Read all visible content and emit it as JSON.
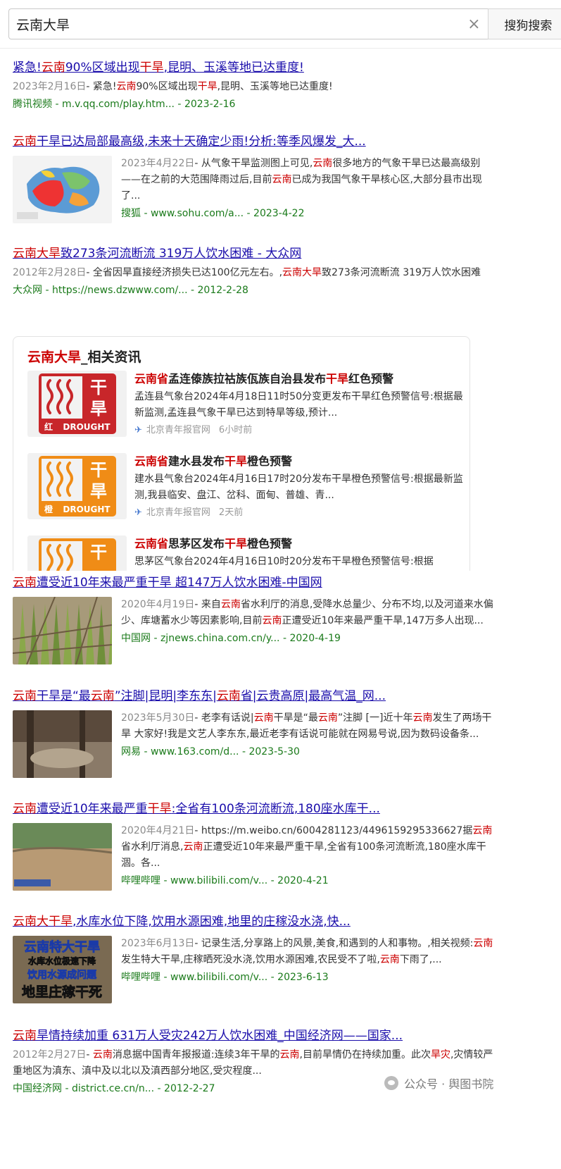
{
  "search": {
    "query": "云南大旱",
    "button_label": "搜狗搜索",
    "clear_label": "×"
  },
  "results": [
    {
      "title_parts": [
        [
          "紧急!",
          ""
        ],
        [
          "云南",
          "em"
        ],
        [
          "90%区域出现",
          ""
        ],
        [
          "干旱",
          "em"
        ],
        [
          ",昆明、玉溪等地已达重度!",
          ""
        ]
      ],
      "date": "2023年2月16日",
      "snippet_parts": [
        [
          "- 紧急!",
          ""
        ],
        [
          "云南",
          "em"
        ],
        [
          "90%区域出现",
          ""
        ],
        [
          "干旱",
          "em"
        ],
        [
          ",昆明、玉溪等地已达重度!",
          ""
        ]
      ],
      "source": "腾讯视频",
      "url": "m.v.qq.com/play.htm...",
      "source_date": "2023-2-16",
      "thumb": ""
    },
    {
      "title_parts": [
        [
          "云南",
          "em"
        ],
        [
          "干旱已达局部最高级,未来十天确定少雨!分析:等季风爆发_大...",
          ""
        ]
      ],
      "date": "2023年4月22日",
      "snippet_parts": [
        [
          "- 从气象干旱监测图上可见,",
          ""
        ],
        [
          "云南",
          "em"
        ],
        [
          "很多地方的气象干旱已达最高级别——在之前的大范围降雨过后,目前",
          ""
        ],
        [
          "云南",
          "em"
        ],
        [
          "已成为我国气象干旱核心区,大部分县市出现了...",
          ""
        ]
      ],
      "source": "搜狐",
      "url": "www.sohu.com/a...",
      "source_date": "2023-4-22",
      "thumb": "map"
    },
    {
      "title_parts": [
        [
          "云南大旱",
          "em"
        ],
        [
          "致273条河流断流 319万人饮水困难 - 大众网",
          ""
        ]
      ],
      "date": "2012年2月28日",
      "snippet_parts": [
        [
          "- 全省因旱直接经济损失已达100亿元左右。,",
          ""
        ],
        [
          "云南大旱",
          "em"
        ],
        [
          "致273条河流断流 319万人饮水困难",
          ""
        ]
      ],
      "source": "大众网",
      "url": "https://news.dzwww.com/...",
      "source_date": "2012-2-28",
      "thumb": ""
    }
  ],
  "related": {
    "head_em": "云南大旱",
    "head_rest": "_相关资讯",
    "items": [
      {
        "title_parts": [
          [
            "云南省",
            "em"
          ],
          [
            "孟连傣族拉祜族佤族自治县发布",
            ""
          ],
          [
            "干旱",
            "em"
          ],
          [
            "红色预警",
            ""
          ]
        ],
        "desc": "孟连县气象台2024年4月18日11时50分变更发布干旱红色预警信号:根据最新监测,孟连县气象干旱已达到特旱等级,预计...",
        "publisher": "北京青年报官网",
        "time": "6小时前",
        "badge_color": "#c8262a",
        "badge_word": "红",
        "badge_top": "干",
        "badge_bottom": "旱",
        "badge_en": "DROUGHT"
      },
      {
        "title_parts": [
          [
            "云南省",
            "em"
          ],
          [
            "建水县发布",
            ""
          ],
          [
            "干旱",
            "em"
          ],
          [
            "橙色预警",
            ""
          ]
        ],
        "desc": "建水县气象台2024年4月16日17时20分发布干旱橙色预警信号:根据最新监测,我县临安、盘江、岔科、面甸、普雄、青...",
        "publisher": "北京青年报官网",
        "time": "2天前",
        "badge_color": "#f08c16",
        "badge_word": "橙",
        "badge_top": "干",
        "badge_bottom": "旱",
        "badge_en": "DROUGHT"
      },
      {
        "title_parts": [
          [
            "云南省",
            "em"
          ],
          [
            "思茅区发布",
            ""
          ],
          [
            "干旱",
            "em"
          ],
          [
            "橙色预警",
            ""
          ]
        ],
        "desc": "思茅区气象台2024年4月16日10时20分发布干旱橙色预警信号:根据",
        "publisher": "",
        "time": "",
        "badge_color": "#f08c16",
        "badge_word": "",
        "badge_top": "干",
        "badge_bottom": "",
        "badge_en": ""
      }
    ]
  },
  "results2": [
    {
      "title_parts": [
        [
          "云南",
          "em"
        ],
        [
          "遭受近10年来最严重干旱 超147万人饮水困难-中国网",
          ""
        ]
      ],
      "date": "2020年4月19日",
      "snippet_parts": [
        [
          "- 来自",
          ""
        ],
        [
          "云南",
          "em"
        ],
        [
          "省水利厅的消息,受降水总量少、分布不均,以及河道来水偏少、库塘蓄水少等因素影响,目前",
          ""
        ],
        [
          "云南",
          "em"
        ],
        [
          "正遭受近10年来最严重干旱,147万多人出现...",
          ""
        ]
      ],
      "source": "中国网",
      "url": "zjnews.china.com.cn/y...",
      "source_date": "2020-4-19",
      "thumb": "crops"
    },
    {
      "title_parts": [
        [
          "云南",
          "em"
        ],
        [
          "干旱是“最",
          ""
        ],
        [
          "云南",
          "em"
        ],
        [
          "”注脚|昆明|李东东|",
          ""
        ],
        [
          "云南",
          "em"
        ],
        [
          "省|云贵高原|最高气温_网...",
          ""
        ]
      ],
      "date": "2023年5月30日",
      "snippet_parts": [
        [
          "- 老李有话说|",
          ""
        ],
        [
          "云南",
          "em"
        ],
        [
          "干旱是“最",
          ""
        ],
        [
          "云南",
          "em"
        ],
        [
          "”注脚 [一]近十年",
          ""
        ],
        [
          "云南",
          "em"
        ],
        [
          "发生了两场干旱 大家好!我是文艺人李东东,最近老李有话说可能就在网易号说,因为数码设备条...",
          ""
        ]
      ],
      "source": "网易",
      "url": "www.163.com/d...",
      "source_date": "2023-5-30",
      "thumb": "forest"
    },
    {
      "title_parts": [
        [
          "云南",
          "em"
        ],
        [
          "遭受近10年来最严重",
          ""
        ],
        [
          "干旱",
          "em"
        ],
        [
          ":全省有100条河流断流,180座水库干...",
          ""
        ]
      ],
      "date": "2020年4月21日",
      "snippet_parts": [
        [
          "- https://m.weibo.cn/6004281123/4496159295336627据",
          ""
        ],
        [
          "云南",
          "em"
        ],
        [
          "省水利厅消息,",
          ""
        ],
        [
          "云南",
          "em"
        ],
        [
          "正遭受近10年来最严重干旱,全省有100条河流断流,180座水库干涸。各...",
          ""
        ]
      ],
      "source": "哔哩哔哩",
      "url": "www.bilibili.com/v...",
      "source_date": "2020-4-21",
      "thumb": "reservoir"
    },
    {
      "title_parts": [
        [
          "云南大干旱",
          "em"
        ],
        [
          ",水库水位下降,饮用水源困难,地里的庄稼没水浇,快...",
          ""
        ]
      ],
      "date": "2023年6月13日",
      "snippet_parts": [
        [
          "- 记录生活,分享路上的风景,美食,和遇到的人和事物。,相关视频:",
          ""
        ],
        [
          "云南",
          "em"
        ],
        [
          "发生特大干旱,庄稼晒死没水浇,饮用水源困难,农民受不了啦,",
          ""
        ],
        [
          "云南",
          "em"
        ],
        [
          "下雨了,...",
          ""
        ]
      ],
      "source": "哔哩哔哩",
      "url": "www.bilibili.com/v...",
      "source_date": "2023-6-13",
      "thumb": "video",
      "thumb_lines": [
        "云南特大干旱",
        "水库水位极速下降",
        "饮用水源成问题",
        "地里庄稼干死"
      ]
    },
    {
      "title_parts": [
        [
          "云南",
          "em"
        ],
        [
          "旱情持续加重 631万人受灾242万人饮水困难_中国经济网——国家...",
          ""
        ]
      ],
      "date": "2012年2月27日",
      "snippet_parts": [
        [
          "- ",
          ""
        ],
        [
          "云南",
          "em"
        ],
        [
          "消息据中国青年报报道:连续3年干旱的",
          ""
        ],
        [
          "云南",
          "em"
        ],
        [
          ",目前旱情仍在持续加重。此次",
          ""
        ],
        [
          "旱灾",
          "em"
        ],
        [
          ",灾情较严重地区为滇东、滇中及以北以及滇西部分地区,受灾程度...",
          ""
        ]
      ],
      "source": "中国经济网",
      "url": "district.ce.cn/n...",
      "source_date": "2012-2-27",
      "thumb": ""
    }
  ],
  "watermark": "公众号 · 舆图书院"
}
